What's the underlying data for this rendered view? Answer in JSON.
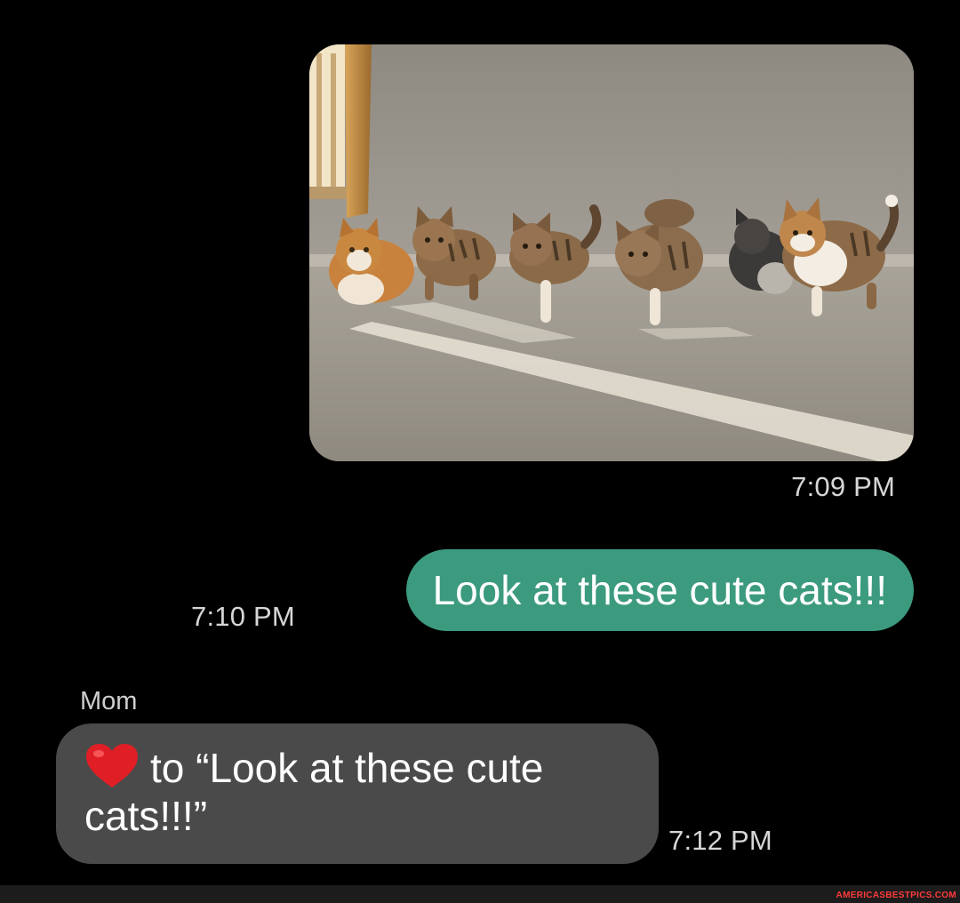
{
  "thread": {
    "image_message": {
      "timestamp": "7:09 PM"
    },
    "sent_message": {
      "text": "Look at these cute cats!!!",
      "timestamp": "7:10 PM"
    },
    "received_message": {
      "sender": "Mom",
      "reaction_icon": "red-heart-emoji",
      "text": "to “Look at these cute cats!!!”",
      "timestamp": "7:12 PM"
    }
  },
  "watermark": "AMERICASBESTPICS.COM",
  "colors": {
    "background": "#000000",
    "sent_bubble": "#3c9a7f",
    "received_bubble": "#4a4a4a",
    "heart": "#e01e26",
    "watermark": "#ff3a3a"
  }
}
